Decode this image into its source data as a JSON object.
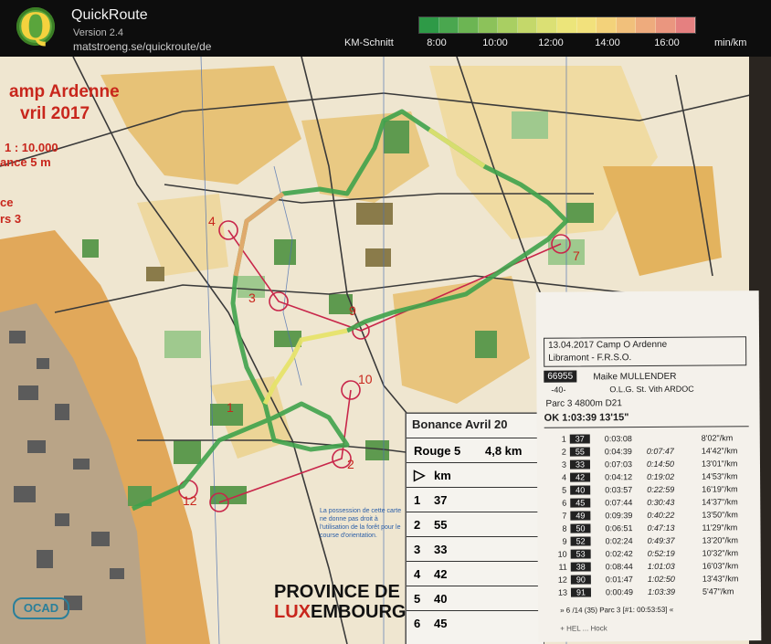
{
  "app": {
    "title": "QuickRoute",
    "version": "Version 2.4",
    "url": "matstroeng.se/quickroute/de"
  },
  "legend": {
    "label": "KM-Schnitt",
    "ticks": [
      "8:00",
      "10:00",
      "12:00",
      "14:00",
      "16:00"
    ],
    "unit": "min/km",
    "gradient_colors": [
      "#2e9a47",
      "#4aa74f",
      "#6cb553",
      "#8cc25a",
      "#a9cf62",
      "#c4d86a",
      "#dbe074",
      "#ece57a",
      "#f2e17c",
      "#f3d27a",
      "#f1c07b",
      "#eeab7d",
      "#ea967f",
      "#e58080"
    ]
  },
  "map": {
    "title_line1": "amp Ardenne",
    "title_line2": "vril 2017",
    "scale": "1 : 10.000",
    "equidistance": "ance  5 m",
    "side_text1": "ce",
    "side_text2": "rs 3",
    "control_numbers": [
      "1",
      "2",
      "3",
      "4",
      "7",
      "9",
      "10",
      "12"
    ],
    "disclaimer": "La possession de cette carte ne donne pas droit à l'utilisation de la forêt pour le course d'orientation.",
    "province_line1": "PROVINCE DE",
    "province_lux": "LUX",
    "province_rest": "EMBOURG",
    "ocad": "OCAD"
  },
  "description_sheet": {
    "title": "Bonance Avril 20",
    "course": "Rouge 5",
    "distance": "4,8 km",
    "km_label": "km",
    "rows": [
      {
        "num": "1",
        "code": "37"
      },
      {
        "num": "2",
        "code": "55"
      },
      {
        "num": "3",
        "code": "33"
      },
      {
        "num": "4",
        "code": "42"
      },
      {
        "num": "5",
        "code": "40"
      },
      {
        "num": "6",
        "code": "45"
      }
    ]
  },
  "ticket": {
    "event_line1": "13.04.2017  Camp O Ardenne",
    "event_line2": "Libramont - F.R.S.O.",
    "runner_id": "66955",
    "runner_name": "Maike MULLENDER",
    "club_no": "-40-",
    "club": "O.L.G. St. Vith ARDOC",
    "parc": "Parc      3      4800m            D21",
    "status": "OK          1:03:39        13'15\"",
    "splits": [
      {
        "idx": "1",
        "code": "37",
        "time": "0:03:08",
        "cum": "",
        "pace": "8'02\"/km"
      },
      {
        "idx": "2",
        "code": "55",
        "time": "0:04:39",
        "cum": "0:07:47",
        "pace": "14'42\"/km"
      },
      {
        "idx": "3",
        "code": "33",
        "time": "0:07:03",
        "cum": "0:14:50",
        "pace": "13'01\"/km"
      },
      {
        "idx": "4",
        "code": "42",
        "time": "0:04:12",
        "cum": "0:19:02",
        "pace": "14'53\"/km"
      },
      {
        "idx": "5",
        "code": "40",
        "time": "0:03:57",
        "cum": "0:22:59",
        "pace": "16'19\"/km"
      },
      {
        "idx": "6",
        "code": "45",
        "time": "0:07:44",
        "cum": "0:30:43",
        "pace": "14'37\"/km"
      },
      {
        "idx": "7",
        "code": "49",
        "time": "0:09:39",
        "cum": "0:40:22",
        "pace": "13'50\"/km"
      },
      {
        "idx": "8",
        "code": "50",
        "time": "0:06:51",
        "cum": "0:47:13",
        "pace": "11'29\"/km"
      },
      {
        "idx": "9",
        "code": "52",
        "time": "0:02:24",
        "cum": "0:49:37",
        "pace": "13'20\"/km"
      },
      {
        "idx": "10",
        "code": "53",
        "time": "0:02:42",
        "cum": "0:52:19",
        "pace": "10'32\"/km"
      },
      {
        "idx": "11",
        "code": "38",
        "time": "0:08:44",
        "cum": "1:01:03",
        "pace": "16'03\"/km"
      },
      {
        "idx": "12",
        "code": "90",
        "time": "0:01:47",
        "cum": "1:02:50",
        "pace": "13'43\"/km"
      },
      {
        "idx": "13",
        "code": "91",
        "time": "0:00:49",
        "cum": "1:03:39",
        "pace": "5'47\"/km"
      }
    ],
    "footer": "» 6 /14 (35) Parc 3 [#1: 00:53:53] «",
    "footer2": "+ HEL ... Hock"
  }
}
